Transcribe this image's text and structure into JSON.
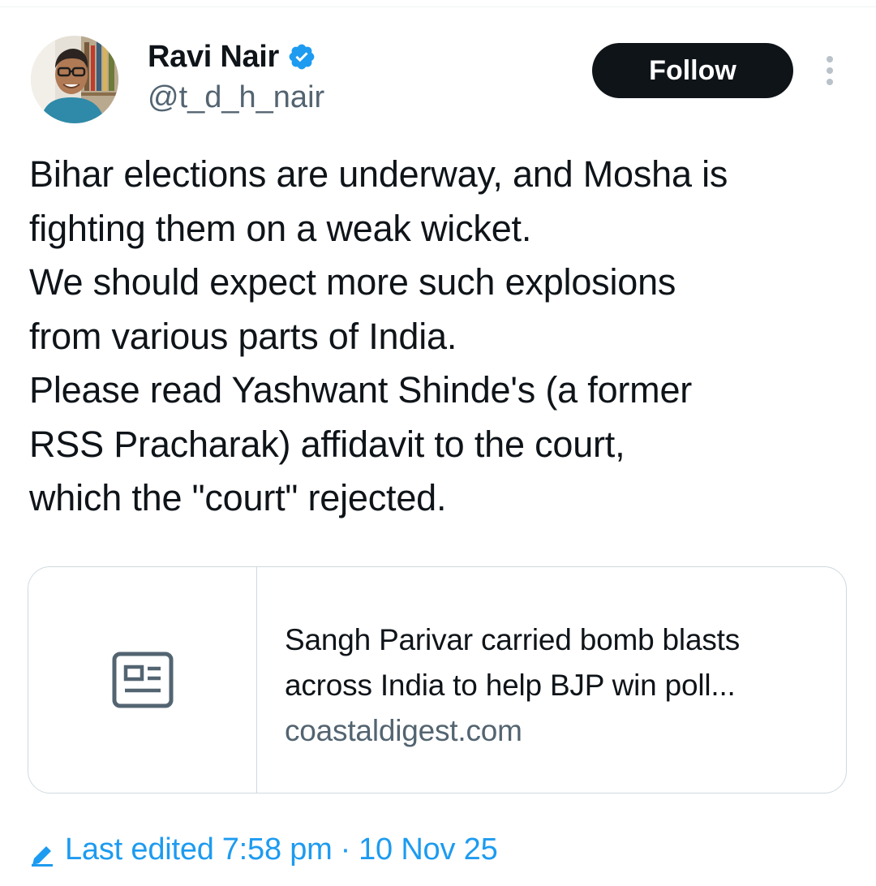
{
  "author": {
    "display_name": "Ravi Nair",
    "handle": "@t_d_h_nair",
    "verified": true,
    "verified_badge_color": "#1d9bf0",
    "avatar_icon": "profile-photo"
  },
  "actions": {
    "follow_label": "Follow",
    "more_icon": "more-vertical-icon"
  },
  "tweet": {
    "lines": [
      "Bihar elections are underway, and Mosha is",
      "fighting them on a weak wicket.",
      "We should expect more such explosions",
      "from various parts of India.",
      "Please read Yashwant Shinde's (a former",
      "RSS Pracharak) affidavit to the court,",
      "which the \"court\" rejected."
    ]
  },
  "link_card": {
    "icon": "article-icon",
    "title_lines": [
      "Sangh Parivar carried bomb blasts",
      "across India to help BJP win poll..."
    ],
    "domain": "coastaldigest.com"
  },
  "edit_info": {
    "icon": "edit-pencil-icon",
    "label": "Last edited",
    "time": "7:58 pm",
    "separator": "·",
    "date": "10 Nov 25"
  },
  "colors": {
    "text_primary": "#0f1419",
    "text_secondary": "#536471",
    "accent": "#1d9bf0",
    "border": "#cfd9de",
    "button_bg": "#0f1419"
  }
}
